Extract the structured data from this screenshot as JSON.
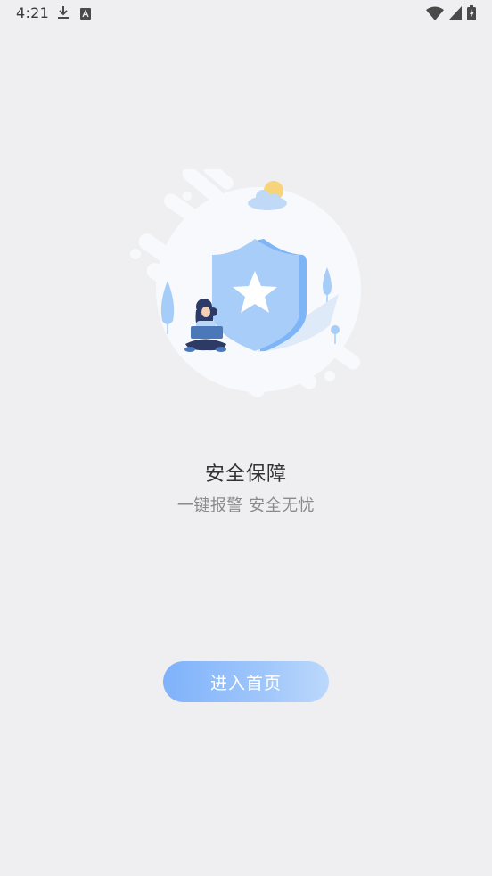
{
  "status_bar": {
    "time": "4:21",
    "left_icons": [
      "download-icon",
      "a-badge-icon"
    ],
    "right_icons": [
      "wifi-icon",
      "signal-icon",
      "battery-icon"
    ]
  },
  "illustration": {
    "description_icons": [
      "shield-star-icon",
      "person-laptop-icon",
      "cloud-sun-icon",
      "tree-icon"
    ]
  },
  "main": {
    "title": "安全保障",
    "subtitle": "一键报警 安全无忧"
  },
  "enter_button": {
    "label": "进入首页"
  },
  "colors": {
    "background": "#efeff1",
    "button_gradient_start": "#7fb2fb",
    "button_gradient_end": "#bcd8fb",
    "shield": "#9cc6f7",
    "title_text": "#333333",
    "subtitle_text": "#8a8a8a"
  }
}
